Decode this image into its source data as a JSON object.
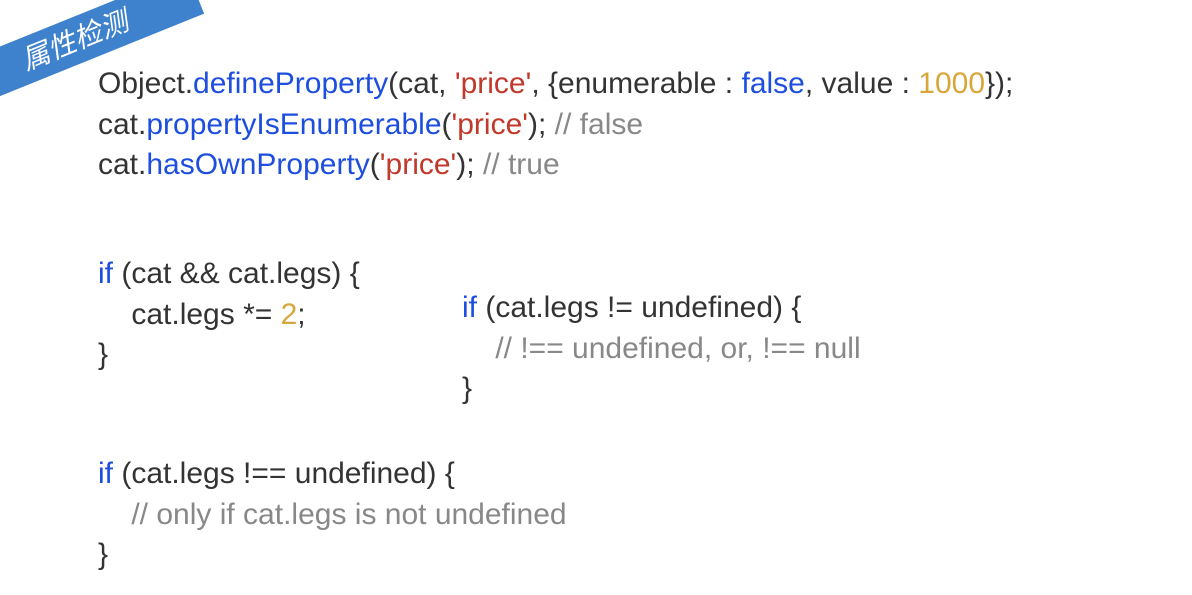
{
  "ribbon": {
    "label": "属性检测"
  },
  "snippet1": {
    "l1_p1": "Object.",
    "l1_p2": "defineProperty",
    "l1_p3": "(cat, ",
    "l1_str": "'price'",
    "l1_p4": ", {enumerable : ",
    "l1_false": "false",
    "l1_p5": ", value : ",
    "l1_num": "1000",
    "l1_p6": "});",
    "l2_p1": "cat.",
    "l2_p2": "propertyIsEnumerable",
    "l2_p3": "(",
    "l2_str": "'price'",
    "l2_p4": "); ",
    "l2_c": "// false",
    "l3_p1": "cat.",
    "l3_p2": "hasOwnProperty",
    "l3_p3": "(",
    "l3_str": "'price'",
    "l3_p4": "); ",
    "l3_c": "// true"
  },
  "snippet2": {
    "l1_p1": "if",
    "l1_p2": " (cat && cat.legs) {",
    "l2": "    cat.legs *= ",
    "l2_num": "2",
    "l2_p2": ";",
    "l3": "}"
  },
  "snippet3": {
    "l1_p1": "if",
    "l1_p2": " (cat.legs != undefined) {",
    "l2_pre": "    ",
    "l2": "// !== undefined, or, !== null",
    "l3": "}"
  },
  "snippet4": {
    "l1_p1": "if",
    "l1_p2": " (cat.legs !== undefined) {",
    "l2_pre": "    ",
    "l2": "// only if cat.legs is not undefined",
    "l3": "}"
  }
}
